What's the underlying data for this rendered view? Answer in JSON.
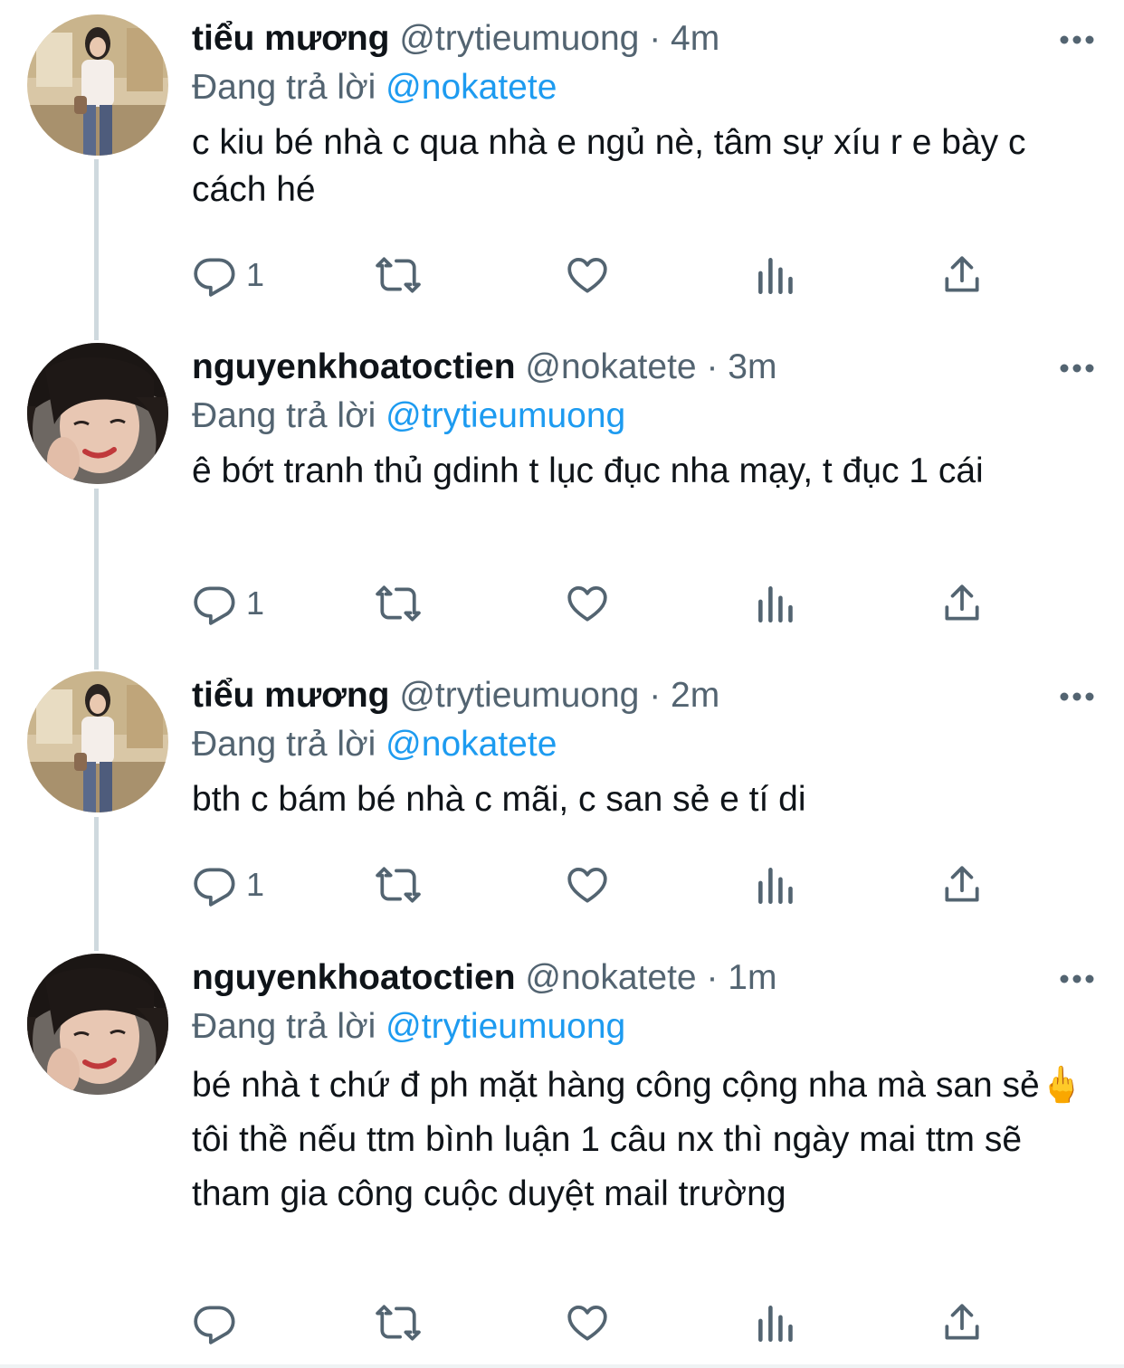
{
  "colors": {
    "accent": "#1d9bf0",
    "secondary_text": "#536471",
    "primary_text": "#0f1419",
    "thread_line": "#cfd9de"
  },
  "icons": {
    "reply": "reply-icon",
    "retweet": "retweet-icon",
    "like": "heart-icon",
    "views": "analytics-icon",
    "share": "share-icon",
    "more": "more-icon"
  },
  "tweets": [
    {
      "display_name": "tiểu mương",
      "handle": "@trytieumuong",
      "dot": "·",
      "time": "4m",
      "replying_prefix": "Đang trả lời",
      "replying_to": "@nokatete",
      "text": "c kiu bé nhà c qua nhà e ngủ nè, tâm sự xíu r e bày c cách hé",
      "reply_count": "1"
    },
    {
      "display_name": "nguyenkhoatoctien",
      "handle": "@nokatete",
      "dot": "·",
      "time": "3m",
      "replying_prefix": "Đang trả lời",
      "replying_to": "@trytieumuong",
      "text": "ê bớt tranh thủ gdinh t lục đục nha mạy, t đục 1 cái",
      "reply_count": "1"
    },
    {
      "display_name": "tiểu mương",
      "handle": "@trytieumuong",
      "dot": "·",
      "time": "2m",
      "replying_prefix": "Đang trả lời",
      "replying_to": "@nokatete",
      "text": "bth c bám bé nhà c mãi, c san sẻ e tí di",
      "reply_count": "1"
    },
    {
      "display_name": "nguyenkhoatoctien",
      "handle": "@nokatete",
      "dot": "·",
      "time": "1m",
      "replying_prefix": "Đang trả lời",
      "replying_to": "@trytieumuong",
      "text": "bé nhà t chứ đ ph mặt hàng công cộng nha mà san sẻ🖕\ntôi thề nếu ttm bình luận 1 câu nx thì ngày mai ttm sẽ tham gia công cuộc duyệt mail trường",
      "reply_count": ""
    }
  ]
}
